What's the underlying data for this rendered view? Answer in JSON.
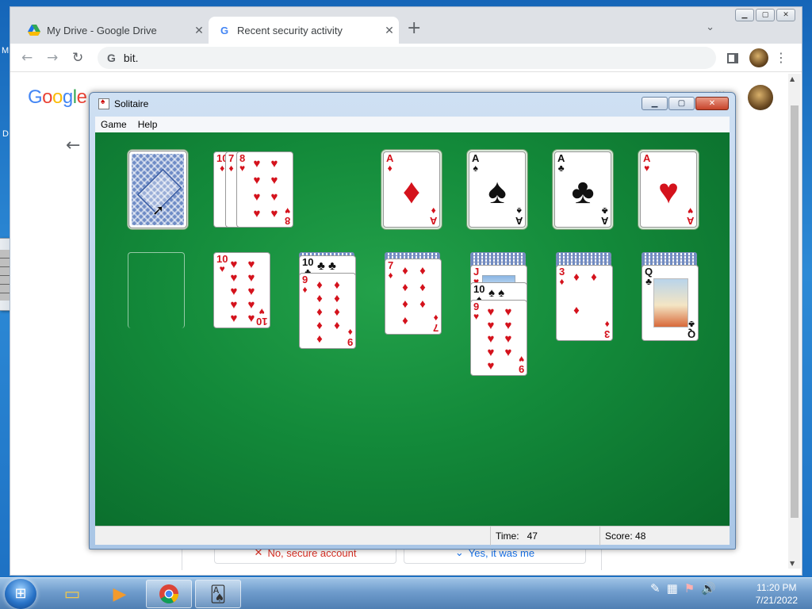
{
  "desktop": {
    "left_letters": [
      "M",
      "D"
    ]
  },
  "browser": {
    "tabs": [
      {
        "title": "My Drive - Google Drive",
        "favicon": "google-drive-icon"
      },
      {
        "title": "Recent security activity",
        "favicon": "google-g-icon"
      }
    ],
    "new_tab": "+",
    "close_glyph": "✕",
    "address": "bit.",
    "page": {
      "logo": "Google",
      "back_icon": "←",
      "btn_no": "No, secure account",
      "btn_yes": "Yes, it was me"
    }
  },
  "solitaire": {
    "title": "Solitaire",
    "menu": [
      "Game",
      "Help"
    ],
    "status": {
      "time_label": "Time:",
      "time_value": "47",
      "score_label": "Score: 48"
    },
    "waste": [
      {
        "rank": "10",
        "suit": "♦"
      },
      {
        "rank": "7",
        "suit": "♦"
      },
      {
        "rank": "8",
        "suit": "♥"
      }
    ],
    "foundations": [
      {
        "rank": "A",
        "suit": "♦",
        "color": "red"
      },
      {
        "rank": "A",
        "suit": "♠",
        "color": "black"
      },
      {
        "rank": "A",
        "suit": "♣",
        "color": "black"
      },
      {
        "rank": "A",
        "suit": "♥",
        "color": "red"
      }
    ],
    "tableau": [
      {
        "hidden": 0,
        "cards": []
      },
      {
        "hidden": 0,
        "cards": [
          {
            "rank": "10",
            "suit": "♥",
            "color": "red"
          }
        ]
      },
      {
        "hidden": 1,
        "cards": [
          {
            "rank": "10",
            "suit": "♣",
            "color": "black"
          },
          {
            "rank": "9",
            "suit": "♦",
            "color": "red"
          }
        ]
      },
      {
        "hidden": 2,
        "cards": [
          {
            "rank": "7",
            "suit": "♦",
            "color": "red"
          }
        ]
      },
      {
        "hidden": 4,
        "cards": [
          {
            "rank": "J",
            "suit": "♥",
            "color": "red"
          },
          {
            "rank": "10",
            "suit": "♠",
            "color": "black"
          },
          {
            "rank": "9",
            "suit": "♥",
            "color": "red"
          }
        ]
      },
      {
        "hidden": 4,
        "cards": [
          {
            "rank": "3",
            "suit": "♦",
            "color": "red"
          }
        ]
      },
      {
        "hidden": 4,
        "cards": [
          {
            "rank": "Q",
            "suit": "♣",
            "color": "black"
          }
        ]
      }
    ]
  },
  "taskbar": {
    "items": [
      "windows-explorer-icon",
      "media-player-icon",
      "chrome-icon",
      "solitaire-icon"
    ],
    "clock_time": "11:20 PM",
    "clock_date": "7/21/2022"
  }
}
